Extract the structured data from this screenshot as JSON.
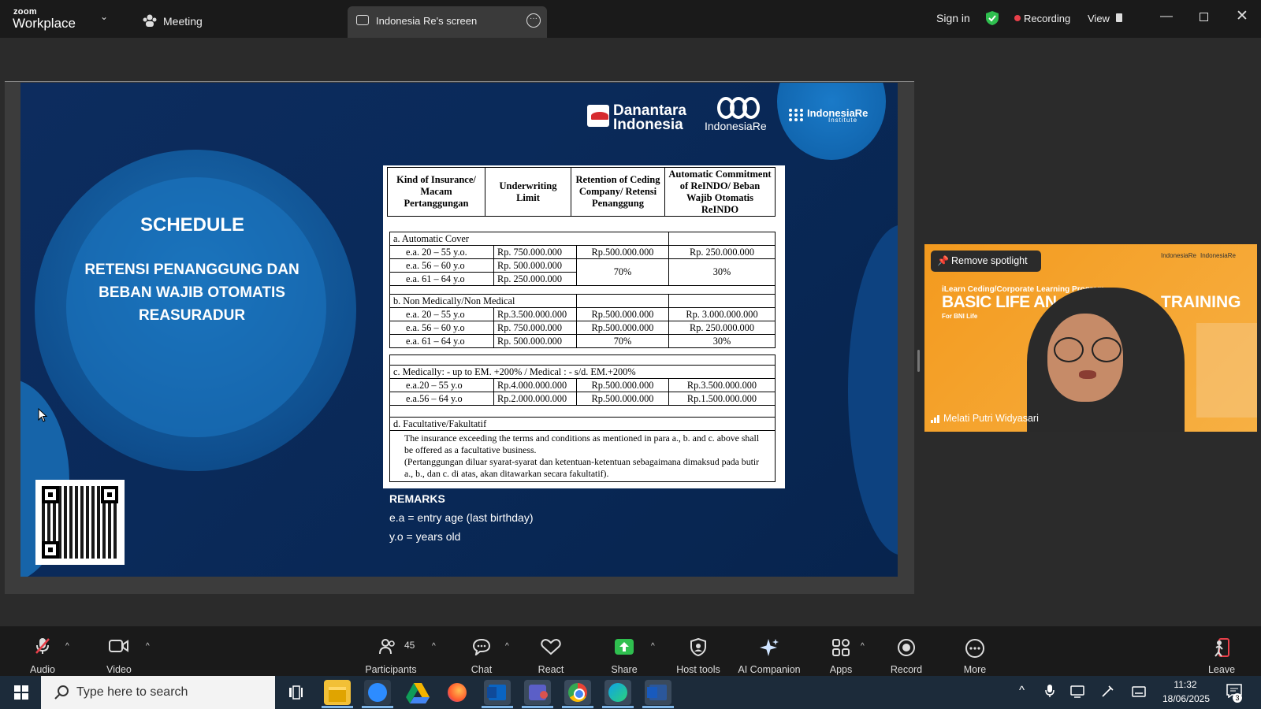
{
  "app": {
    "logo_top": "zoom",
    "logo_bottom": "Workplace"
  },
  "topbar": {
    "meeting_label": "Meeting",
    "share_tab_label": "Indonesia Re's screen",
    "sign_in": "Sign in",
    "recording": "Recording",
    "view": "View",
    "colors": {
      "recording_dot": "#e8404a",
      "shield": "#2fbf4f"
    }
  },
  "slide": {
    "title": "SCHEDULE",
    "subtitle": "RETENSI PENANGGUNG DAN BEBAN WAJIB OTOMATIS REASURADUR",
    "logos": {
      "danantara": "Danantara Indonesia",
      "indonesiare": "IndonesiaRe",
      "institute": "IndonesiaRe",
      "institute_sub": "Institute"
    },
    "table": {
      "headers": [
        "Kind of Insurance/ Macam Pertanggungan",
        "Underwriting Limit",
        "Retention of Ceding Company/ Retensi Penanggung",
        "Automatic Commitment of ReINDO/ Beban Wajib Otomatis ReINDO"
      ],
      "sec_a": {
        "title": "a. Automatic Cover",
        "rows": [
          {
            "label": "e.a. 20 – 55 y.o.",
            "limit": "Rp.   750.000.000",
            "retention": "Rp.500.000.000",
            "commit": "Rp.   250.000.000"
          },
          {
            "label": "e.a. 56 – 60 y.o",
            "limit": "Rp.   500.000.000",
            "retention": "70%",
            "commit": "30%"
          },
          {
            "label": "e.a. 61 – 64 y.o",
            "limit": "Rp.   250.000.000",
            "retention": "",
            "commit": ""
          }
        ]
      },
      "sec_b": {
        "title": "b. Non Medically/Non Medical",
        "rows": [
          {
            "label": "e.a. 20 – 55 y.o",
            "limit": "Rp.3.500.000.000",
            "retention": "Rp.500.000.000",
            "commit": "Rp. 3.000.000.000"
          },
          {
            "label": "e.a. 56 – 60 y.o",
            "limit": "Rp.   750.000.000",
            "retention": "Rp.500.000.000",
            "commit": "Rp.   250.000.000"
          },
          {
            "label": "e.a. 61 – 64 y.o",
            "limit": "Rp.   500.000.000",
            "retention": "70%",
            "commit": "30%"
          }
        ]
      },
      "sec_c": {
        "title": "c. Medically: - up to EM. +200% / Medical : - s/d. EM.+200%",
        "rows": [
          {
            "label": "e.a.20 – 55 y.o",
            "limit": "Rp.4.000.000.000",
            "retention": "Rp.500.000.000",
            "commit": "Rp.3.500.000.000"
          },
          {
            "label": "e.a.56 – 64 y.o",
            "limit": "Rp.2.000.000.000",
            "retention": "Rp.500.000.000",
            "commit": "Rp.1.500.000.000"
          }
        ]
      },
      "sec_d": {
        "title": "d. Facultative/Fakultatif",
        "text1": "The insurance exceeding the terms and conditions as mentioned in para a., b. and c. above shall be offered as a facultative business.",
        "text2": "(Pertanggungan diluar syarat-syarat dan ketentuan-ketentuan sebagaimana dimaksud pada butir a., b., dan c. di atas, akan ditawarkan secara fakultatif)."
      }
    },
    "remarks": {
      "title": "REMARKS",
      "line1": "e.a = entry age (last birthday)",
      "line2": "y.o = years old"
    }
  },
  "speaker": {
    "spotlight_button": "Remove spotlight",
    "name": "Melati Putri Widyasari",
    "banner_small": "iLearn Ceding/Corporate Learning Program",
    "banner_big": "BASIC LIFE AN",
    "banner_big_right": "TRAINING",
    "banner_for": "For BNI Life"
  },
  "toolbar": {
    "audio": "Audio",
    "video": "Video",
    "participants": "Participants",
    "participants_count": "45",
    "chat": "Chat",
    "react": "React",
    "share": "Share",
    "host_tools": "Host tools",
    "ai_companion": "AI Companion",
    "apps": "Apps",
    "record": "Record",
    "more": "More",
    "leave": "Leave",
    "colors": {
      "share": "#2fbf4f",
      "leave": "#e8404a"
    }
  },
  "taskbar": {
    "search_placeholder": "Type here to search",
    "time": "11:32",
    "date": "18/06/2025",
    "notification_count": "3"
  }
}
